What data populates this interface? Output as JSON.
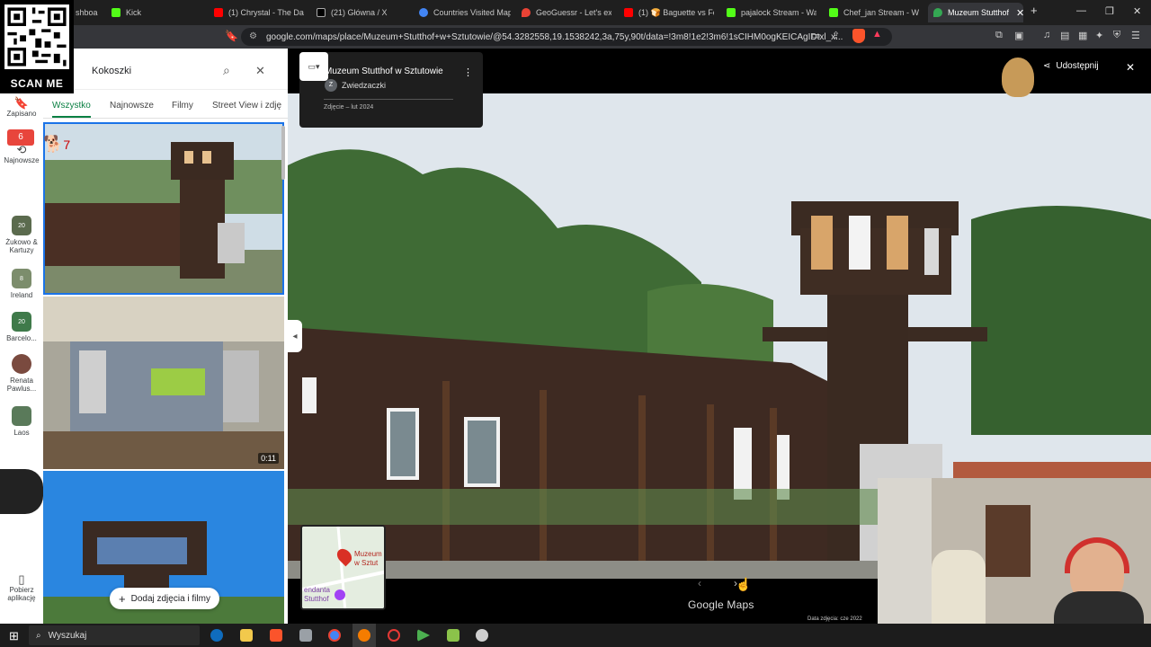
{
  "overlay": {
    "scan_label": "SCAN ME"
  },
  "browser": {
    "tabs": [
      {
        "label": "shboa",
        "color": "#5f6368"
      },
      {
        "label": "Kick",
        "color": "#53fc18"
      },
      {
        "label": "(1) Chrystal - The Days",
        "color": "#ff0000"
      },
      {
        "label": "(21) Główna / X",
        "color": "#000000"
      },
      {
        "label": "Countries Visited Map",
        "color": "#4285f4"
      },
      {
        "label": "GeoGuessr - Let's expl",
        "color": "#ea4335"
      },
      {
        "label": "(1) 🍞 Baguette vs For",
        "color": "#ff0000"
      },
      {
        "label": "pajalock Stream - Wat",
        "color": "#53fc18"
      },
      {
        "label": "Chef_jan Stream - Wat",
        "color": "#53fc18"
      },
      {
        "label": "Muzeum Stutthof",
        "color": "#34a853"
      }
    ],
    "new_tab": "+",
    "url": "google.com/maps/place/Muzeum+Stutthof+w+Sztutowie/@54.3282558,19.1538242,3a,75y,90t/data=!3m8!1e2!3m6!1sCIHM0ogKEICAgIDtxl_x..."
  },
  "rail": {
    "items": [
      {
        "label": "Zapisano",
        "icon": "bookmark-icon"
      },
      {
        "label": "Najnowsze",
        "icon": "history-icon"
      },
      {
        "label": "Żukowo & Kartuzy",
        "badge": "20",
        "color": "#5b6b4e"
      },
      {
        "label": "Ireland",
        "badge": "8",
        "color": "#7c8d6c"
      },
      {
        "label": "Barcelo...",
        "badge": "20",
        "color": "#3f7a4a"
      },
      {
        "label": "Renata Pawlus...",
        "badge": "",
        "color": "#7a4a3f"
      },
      {
        "label": "Laos",
        "badge": "",
        "color": "#5a7a5a"
      },
      {
        "label": "Pobierz aplikację",
        "icon": "phone-icon"
      }
    ]
  },
  "panel": {
    "search_value": "Kokoszki",
    "tabs": [
      "Wszystko",
      "Najnowsze",
      "Filmy",
      "Street View i zdję"
    ],
    "video_duration": "0:11",
    "add_button": "Dodaj zdjęcia i filmy"
  },
  "viewer": {
    "place_title": "Muzeum Stutthof w Sztutowie",
    "contributor_initial": "Z",
    "contributor": "Zwiedzaczki",
    "photo_date": "Zdjęcie – lut 2024",
    "share_label": "Udostępnij",
    "minimap_labels": [
      "Muzeum",
      "w Sztut",
      "endanta",
      "Stutthof"
    ],
    "logo": "Google Maps",
    "image_date": "Data zdjęcia: cze 2022"
  },
  "taskbar": {
    "search_label": "Wyszukaj"
  }
}
